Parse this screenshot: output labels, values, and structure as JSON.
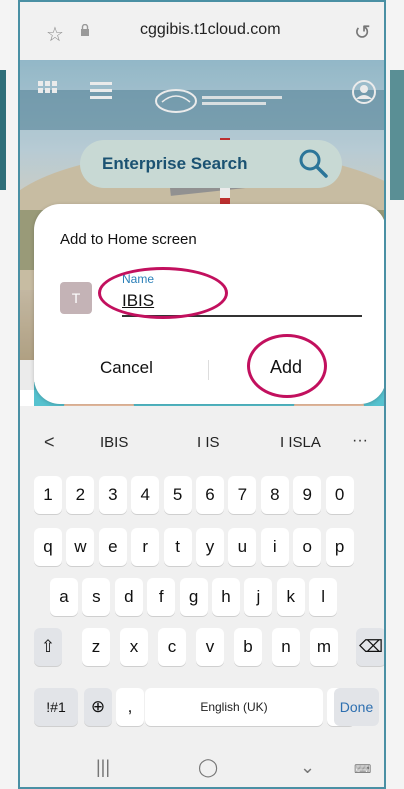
{
  "browser": {
    "url": "cggibis.t1cloud.com"
  },
  "page": {
    "search_placeholder": "Enterprise Search"
  },
  "dialog": {
    "title": "Add to Home screen",
    "app_tile_letter": "T",
    "name_label": "Name",
    "name_value": "IBIS",
    "cancel_label": "Cancel",
    "add_label": "Add"
  },
  "annotation_color": "#c2105e",
  "keyboard": {
    "suggestions": [
      "IBIS",
      "I IS",
      "I ISLA"
    ],
    "more_label": "···",
    "row_numbers": [
      "1",
      "2",
      "3",
      "4",
      "5",
      "6",
      "7",
      "8",
      "9",
      "0"
    ],
    "row_top": [
      "q",
      "w",
      "e",
      "r",
      "t",
      "y",
      "u",
      "i",
      "o",
      "p"
    ],
    "row_middle": [
      "a",
      "s",
      "d",
      "f",
      "g",
      "h",
      "j",
      "k",
      "l"
    ],
    "row_bottom": [
      "z",
      "x",
      "c",
      "v",
      "b",
      "n",
      "m"
    ],
    "symbols_label": "!#1",
    "comma_label": ",",
    "space_label": "English (UK)",
    "period_label": ".",
    "done_label": "Done"
  }
}
